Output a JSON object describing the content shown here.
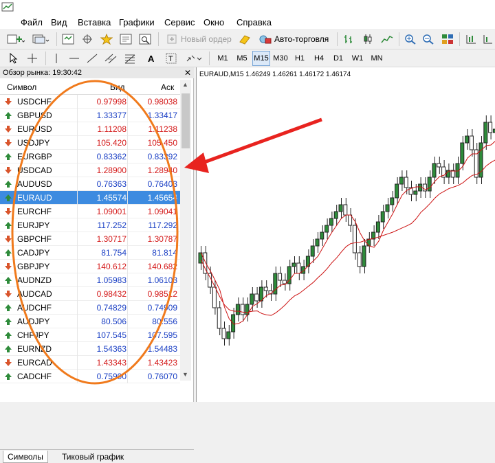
{
  "menu": [
    "Файл",
    "Вид",
    "Вставка",
    "Графики",
    "Сервис",
    "Окно",
    "Справка"
  ],
  "toolbar": {
    "new_order": "Новый ордер",
    "auto_trading": "Авто-торговля",
    "timeframes": [
      "M1",
      "M5",
      "M15",
      "M30",
      "H1",
      "H4",
      "D1",
      "W1",
      "MN"
    ],
    "active_timeframe": "M15"
  },
  "market_watch": {
    "title": "Обзор рынка: 19:30:42",
    "columns": {
      "symbol": "Символ",
      "bid": "Бид",
      "ask": "Аск"
    },
    "rows": [
      {
        "symbol": "USDCHF",
        "bid": "0.97998",
        "ask": "0.98038",
        "dir": "down"
      },
      {
        "symbol": "GBPUSD",
        "bid": "1.33377",
        "ask": "1.33417",
        "dir": "up"
      },
      {
        "symbol": "EURUSD",
        "bid": "1.11208",
        "ask": "1.11238",
        "dir": "down"
      },
      {
        "symbol": "USDJPY",
        "bid": "105.420",
        "ask": "105.450",
        "dir": "down"
      },
      {
        "symbol": "EURGBP",
        "bid": "0.83362",
        "ask": "0.83392",
        "dir": "up"
      },
      {
        "symbol": "USDCAD",
        "bid": "1.28900",
        "ask": "1.28940",
        "dir": "down"
      },
      {
        "symbol": "AUDUSD",
        "bid": "0.76363",
        "ask": "0.76403",
        "dir": "up"
      },
      {
        "symbol": "EURAUD",
        "bid": "1.45574",
        "ask": "1.45654",
        "dir": "up",
        "selected": true
      },
      {
        "symbol": "EURCHF",
        "bid": "1.09001",
        "ask": "1.09041",
        "dir": "down"
      },
      {
        "symbol": "EURJPY",
        "bid": "117.252",
        "ask": "117.292",
        "dir": "up"
      },
      {
        "symbol": "GBPCHF",
        "bid": "1.30717",
        "ask": "1.30787",
        "dir": "down"
      },
      {
        "symbol": "CADJPY",
        "bid": "81.754",
        "ask": "81.814",
        "dir": "up"
      },
      {
        "symbol": "GBPJPY",
        "bid": "140.612",
        "ask": "140.682",
        "dir": "down"
      },
      {
        "symbol": "AUDNZD",
        "bid": "1.05983",
        "ask": "1.06103",
        "dir": "up"
      },
      {
        "symbol": "AUDCAD",
        "bid": "0.98432",
        "ask": "0.98512",
        "dir": "down"
      },
      {
        "symbol": "AUDCHF",
        "bid": "0.74829",
        "ask": "0.74909",
        "dir": "up"
      },
      {
        "symbol": "AUDJPY",
        "bid": "80.506",
        "ask": "80.556",
        "dir": "up"
      },
      {
        "symbol": "CHFJPY",
        "bid": "107.545",
        "ask": "107.595",
        "dir": "up"
      },
      {
        "symbol": "EURNZD",
        "bid": "1.54363",
        "ask": "1.54483",
        "dir": "up"
      },
      {
        "symbol": "EURCAD",
        "bid": "1.43343",
        "ask": "1.43423",
        "dir": "down"
      },
      {
        "symbol": "CADCHF",
        "bid": "0.75990",
        "ask": "0.76070",
        "dir": "up"
      }
    ],
    "tabs": [
      "Символы",
      "Тиковый график"
    ]
  },
  "chart": {
    "title": "EURAUD,M15  1.46249 1.46261 1.46172 1.46174"
  },
  "colors": {
    "up": "#1a3fc4",
    "down": "#d41a1a",
    "bull": "#2e8b3a",
    "bear": "#222222",
    "ma": "#cc1111",
    "annotation_ellipse": "#f07a1c",
    "annotation_arrow": "#e8231f"
  }
}
